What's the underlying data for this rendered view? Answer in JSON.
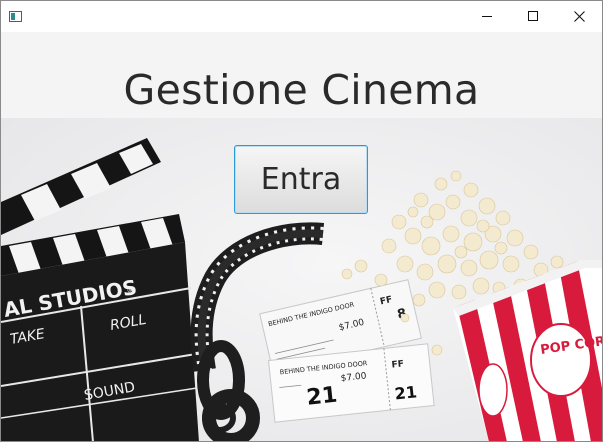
{
  "window": {
    "icon": "app-window-icon",
    "controls": {
      "minimize": "minimize-icon",
      "maximize": "maximize-icon",
      "close": "close-icon"
    }
  },
  "page": {
    "title": "Gestione Cinema",
    "enter_label": "Entra"
  },
  "background_image": {
    "clapperboard_text": {
      "studio": "AL STUDIOS",
      "take": "TAKE",
      "roll": "ROLL",
      "sound": "SOUND"
    },
    "tickets": {
      "movie": "BEHIND THE INDIGO DOOR",
      "price": "$7.00",
      "number": "21",
      "row": "FF",
      "seat": "8"
    },
    "popcorn_box": "POP CORN"
  },
  "colors": {
    "accent": "#2a9bd8",
    "popcorn_red": "#d81b3c"
  }
}
